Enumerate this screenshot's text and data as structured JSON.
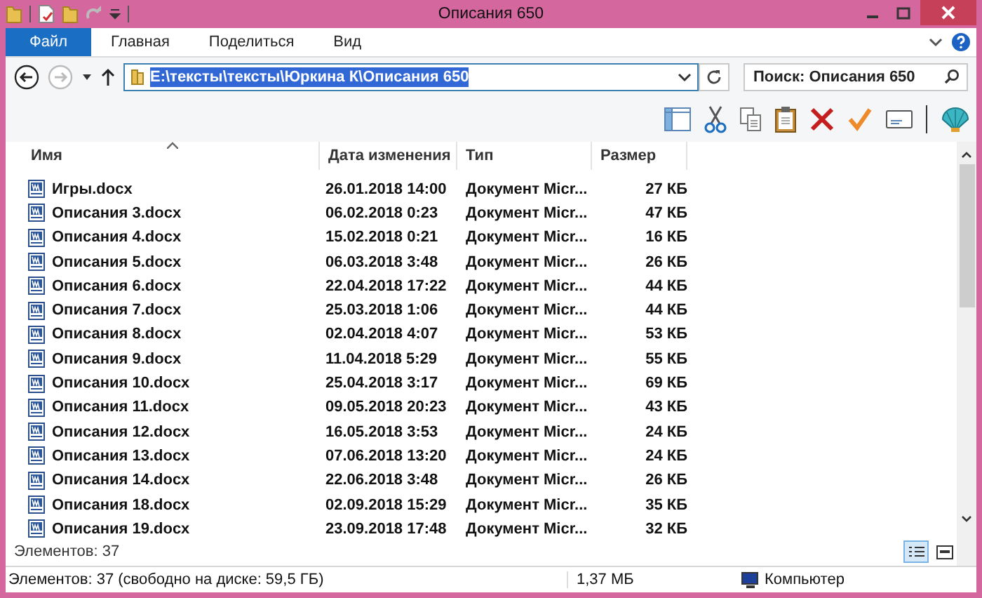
{
  "window": {
    "title": "Описания 650"
  },
  "tabs": [
    {
      "label": "Файл",
      "kind": "file"
    },
    {
      "label": "Главная",
      "kind": "normal"
    },
    {
      "label": "Поделиться",
      "kind": "normal"
    },
    {
      "label": "Вид",
      "kind": "normal"
    }
  ],
  "address": {
    "path": "E:\\тексты\\тексты\\Юркина К\\Описания 650",
    "selected": true
  },
  "search": {
    "placeholder": "Поиск: Описания 650"
  },
  "columns": [
    {
      "label": "Имя",
      "sorted": true
    },
    {
      "label": "Дата изменения",
      "sorted": false
    },
    {
      "label": "Тип",
      "sorted": false
    },
    {
      "label": "Размер",
      "sorted": false
    }
  ],
  "rows": [
    {
      "name": "Игры.docx",
      "date": "26.01.2018 14:00",
      "type": "Документ Micr...",
      "size": "27 КБ"
    },
    {
      "name": "Описания 3.docx",
      "date": "06.02.2018 0:23",
      "type": "Документ Micr...",
      "size": "47 КБ"
    },
    {
      "name": "Описания 4.docx",
      "date": "15.02.2018 0:21",
      "type": "Документ Micr...",
      "size": "16 КБ"
    },
    {
      "name": "Описания 5.docx",
      "date": "06.03.2018 3:48",
      "type": "Документ Micr...",
      "size": "26 КБ"
    },
    {
      "name": "Описания 6.docx",
      "date": "22.04.2018 17:22",
      "type": "Документ Micr...",
      "size": "44 КБ"
    },
    {
      "name": "Описания 7.docx",
      "date": "25.03.2018 1:06",
      "type": "Документ Micr...",
      "size": "44 КБ"
    },
    {
      "name": "Описания 8.docx",
      "date": "02.04.2018 4:07",
      "type": "Документ Micr...",
      "size": "53 КБ"
    },
    {
      "name": "Описания 9.docx",
      "date": "11.04.2018 5:29",
      "type": "Документ Micr...",
      "size": "55 КБ"
    },
    {
      "name": "Описания 10.docx",
      "date": "25.04.2018 3:17",
      "type": "Документ Micr...",
      "size": "69 КБ"
    },
    {
      "name": "Описания 11.docx",
      "date": "09.05.2018 20:23",
      "type": "Документ Micr...",
      "size": "43 КБ"
    },
    {
      "name": "Описания 12.docx",
      "date": "16.05.2018 3:53",
      "type": "Документ Micr...",
      "size": "24 КБ"
    },
    {
      "name": "Описания 13.docx",
      "date": "07.06.2018 13:20",
      "type": "Документ Micr...",
      "size": "24 КБ"
    },
    {
      "name": "Описания 14.docx",
      "date": "22.06.2018 3:48",
      "type": "Документ Micr...",
      "size": "26 КБ"
    },
    {
      "name": "Описания 18.docx",
      "date": "02.09.2018 15:29",
      "type": "Документ Micr...",
      "size": "35 КБ"
    },
    {
      "name": "Описания 19.docx",
      "date": "23.09.2018 17:48",
      "type": "Документ Micr...",
      "size": "32 КБ"
    }
  ],
  "item_count": "Элементов: 37",
  "views": [
    {
      "kind": "details",
      "selected": true
    },
    {
      "kind": "thumbnails",
      "selected": false
    }
  ],
  "status_bar": {
    "summary": "Элементов: 37 (свободно на диске: 59,5 ГБ)",
    "size": "1,37 МБ",
    "location": "Компьютер"
  }
}
